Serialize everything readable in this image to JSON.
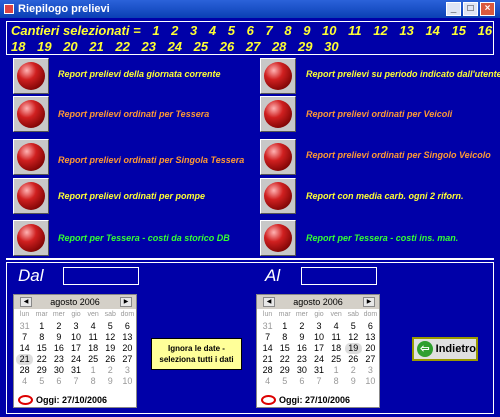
{
  "window": {
    "title": "Riepilogo prelievi",
    "controls": [
      "_",
      "□",
      "×"
    ]
  },
  "header": {
    "caption": "Cantieri selezionati =",
    "line1": [
      "1",
      "2",
      "3",
      "4",
      "5",
      "6",
      "7",
      "8",
      "9",
      "10",
      "11",
      "12",
      "13",
      "14",
      "15",
      "16",
      "17"
    ],
    "line2": [
      "18",
      "19",
      "20",
      "21",
      "22",
      "23",
      "24",
      "25",
      "26",
      "27",
      "28",
      "29",
      "30"
    ]
  },
  "reports_left": [
    {
      "label": "Report prelievi della giornata corrente",
      "color": "#ffff33"
    },
    {
      "label": "Report prelievi ordinati per Tessera",
      "color": "#ff9933"
    },
    {
      "label": "Report prelievi ordinati per Singola Tessera",
      "color": "#ff9933"
    },
    {
      "label": "Report prelievi ordinati per pompe",
      "color": "#ffff33"
    },
    {
      "label": "Report per Tessera - costi da storico DB",
      "color": "#33ff33"
    }
  ],
  "reports_right": [
    {
      "label": "Report prelievi su periodo indicato dall'utente",
      "color": "#ffff33"
    },
    {
      "label": "Report prelievi ordinati per Veicoli",
      "color": "#ff9933"
    },
    {
      "label": "Report prelievi ordinati per Singolo Veicolo",
      "color": "#ff9933"
    },
    {
      "label": "Report con media carb. ogni 2 riforn.",
      "color": "#ffff33"
    },
    {
      "label": "Report per Tessera - costi ins. man.",
      "color": "#33ff33"
    }
  ],
  "dal_label": "Dal",
  "al_label": "Al",
  "calendar_dal": {
    "month": "agosto 2006",
    "weekdays": [
      "lun",
      "mar",
      "mer",
      "gio",
      "ven",
      "sab",
      "dom"
    ],
    "days": [
      "31",
      "1",
      "2",
      "3",
      "4",
      "5",
      "6",
      "7",
      "8",
      "9",
      "10",
      "11",
      "12",
      "13",
      "14",
      "15",
      "16",
      "17",
      "18",
      "19",
      "20",
      "21",
      "22",
      "23",
      "24",
      "25",
      "26",
      "27",
      "28",
      "29",
      "30",
      "31",
      "1",
      "2",
      "3",
      "4",
      "5",
      "6",
      "7",
      "8",
      "9",
      "10"
    ],
    "today": "Oggi: 27/10/2006"
  },
  "calendar_al": {
    "month": "agosto 2006",
    "weekdays": [
      "lun",
      "mar",
      "mer",
      "gio",
      "ven",
      "sab",
      "dom"
    ],
    "days": [
      "31",
      "1",
      "2",
      "3",
      "4",
      "5",
      "6",
      "7",
      "8",
      "9",
      "10",
      "11",
      "12",
      "13",
      "14",
      "15",
      "16",
      "17",
      "18",
      "19",
      "20",
      "21",
      "22",
      "23",
      "24",
      "25",
      "26",
      "27",
      "28",
      "29",
      "30",
      "31",
      "1",
      "2",
      "3",
      "4",
      "5",
      "6",
      "7",
      "8",
      "9",
      "10"
    ],
    "today": "Oggi: 27/10/2006"
  },
  "ignore_button": {
    "line1": "Ignora le date  -",
    "line2": "seleziona tutti i dati"
  },
  "back_button": {
    "label": "Indietro"
  }
}
